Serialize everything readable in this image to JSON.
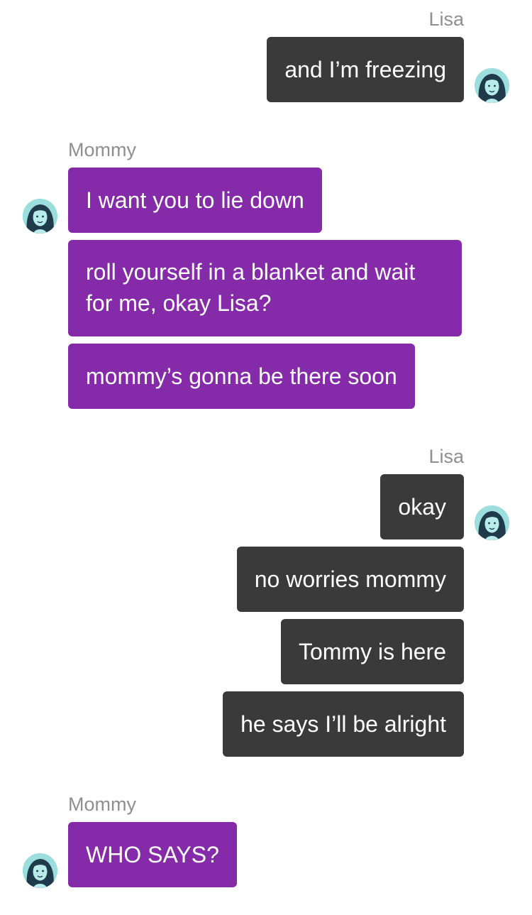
{
  "colors": {
    "outgoing_bubble": "#3a3a3a",
    "incoming_bubble": "#852aa9",
    "sender_name": "#8e8e93",
    "avatar_bg": "#9bdedd",
    "avatar_hair": "#1f3a4a"
  },
  "groups": [
    {
      "side": "right",
      "sender": "Lisa",
      "messages": [
        "and I’m freezing"
      ]
    },
    {
      "side": "left",
      "sender": "Mommy",
      "messages": [
        "I want you to lie down",
        "roll yourself in a blanket and wait for me, okay Lisa?",
        "mommy’s gonna be there soon"
      ]
    },
    {
      "side": "right",
      "sender": "Lisa",
      "messages": [
        "okay",
        "no worries mommy",
        "Tommy is here",
        "he says I’ll be alright"
      ]
    },
    {
      "side": "left",
      "sender": "Mommy",
      "messages": [
        "WHO SAYS?"
      ]
    }
  ],
  "avatar_icon": "woman-portrait-icon"
}
